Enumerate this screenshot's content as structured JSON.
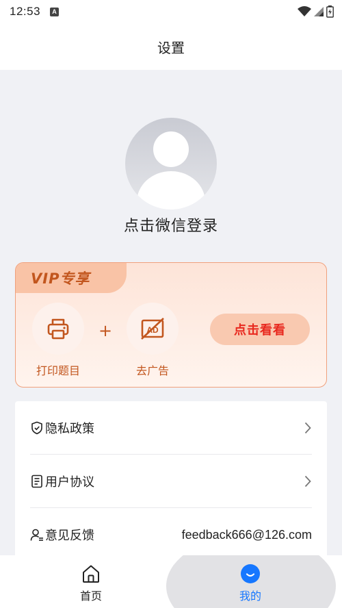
{
  "status_bar": {
    "time": "12:53",
    "notification_letter": "A",
    "icons": [
      "wifi-icon",
      "signal-icon",
      "battery-icon"
    ]
  },
  "header": {
    "title": "设置"
  },
  "profile": {
    "avatar_icon": "default-avatar",
    "login_text": "点击微信登录"
  },
  "vip": {
    "tag": "VIP专享",
    "features": [
      {
        "icon": "printer-icon",
        "label": "打印题目"
      },
      {
        "icon": "no-ad-icon",
        "label": "去广告",
        "icon_text": "AD"
      }
    ],
    "plus": "+",
    "cta_label": "点击看看",
    "colors": {
      "accent": "#c2561e",
      "cta_text": "#e8281e",
      "border": "#f0a07c"
    }
  },
  "menu": {
    "items": [
      {
        "icon": "shield-icon",
        "label": "隐私政策",
        "action": "chevron-right-icon"
      },
      {
        "icon": "document-icon",
        "label": "用户协议",
        "action": "chevron-right-icon"
      },
      {
        "icon": "feedback-user-icon",
        "label": "意见反馈",
        "value": "feedback666@126.com"
      }
    ]
  },
  "tab_bar": {
    "tabs": [
      {
        "icon": "home-icon",
        "label": "首页",
        "active": false
      },
      {
        "icon": "mine-icon",
        "label": "我的",
        "active": true
      }
    ],
    "colors": {
      "active": "#1677ff",
      "inactive": "#222222"
    }
  }
}
